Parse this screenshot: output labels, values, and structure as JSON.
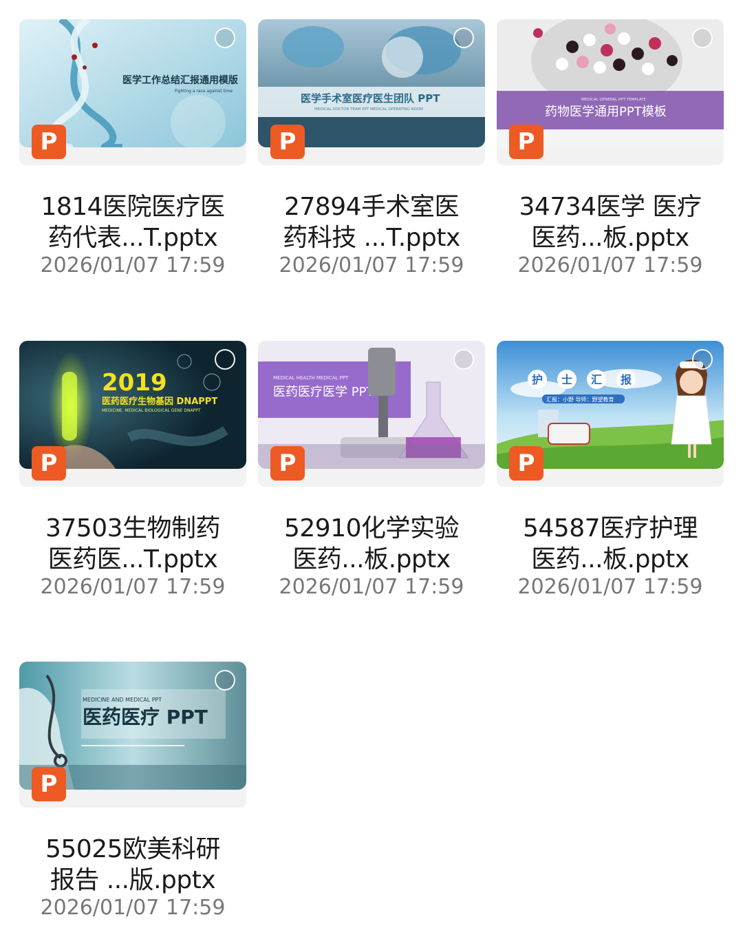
{
  "files": [
    {
      "name_line1": "1814医院医疗医",
      "name_line2": "药代表...T.pptx",
      "time": "2026/01/07 17:59",
      "thumb_title": "医学工作总结汇报通用模版",
      "thumb_sub": "Fighting a race against time"
    },
    {
      "name_line1": "27894手术室医",
      "name_line2": "药科技 ...T.pptx",
      "time": "2026/01/07 17:59",
      "thumb_title": "医学手术室医疗医生团队 PPT",
      "thumb_sub": "MEDICAL DOCTOR TEAM PPT MEDICAL OPERATING ROOM"
    },
    {
      "name_line1": "34734医学 医疗",
      "name_line2": "医药...板.pptx",
      "time": "2026/01/07 17:59",
      "thumb_title": "药物医学通用PPT模板",
      "thumb_sub": "MEDICAL GENERAL PPT TEMPLATE"
    },
    {
      "name_line1": "37503生物制药",
      "name_line2": "医药医...T.pptx",
      "time": "2026/01/07 17:59",
      "thumb_year": "2019",
      "thumb_title": "医药医疗生物基因 DNAPPT",
      "thumb_sub": "MEDICINE. MEDICAL BIOLOGICAL GENE DNAPPT"
    },
    {
      "name_line1": "52910化学实验",
      "name_line2": "医药...板.pptx",
      "time": "2026/01/07 17:59",
      "thumb_title": "医药医疗医学 PPT",
      "thumb_sub": "MEDICAL HEALTH MEDICAL PPT"
    },
    {
      "name_line1": "54587医疗护理",
      "name_line2": "医药...板.pptx",
      "time": "2026/01/07 17:59",
      "thumb_chars": [
        "护",
        "士",
        "汇",
        "报"
      ],
      "thumb_sub": "汇报：小野  导师：野望教育"
    },
    {
      "name_line1": "55025欧美科研",
      "name_line2": "报告 ...版.pptx",
      "time": "2026/01/07 17:59",
      "thumb_title": "医药医疗 PPT",
      "thumb_sub": "MEDICINE AND MEDICAL PPT"
    }
  ],
  "badge_letter": "P",
  "colors": {
    "badge": "#ee5a24",
    "time_text": "#777777"
  }
}
